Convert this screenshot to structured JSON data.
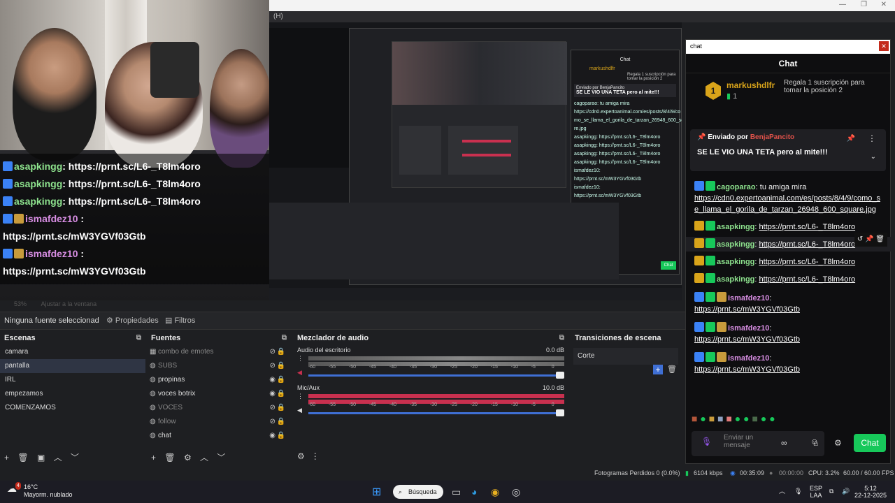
{
  "window": {
    "menu_fragment": "(H)"
  },
  "webcam_overlay": {
    "lines": [
      {
        "user": "asapkingg",
        "text": ": https://prnt.sc/L6-_T8lm4oro"
      },
      {
        "user": "asapkingg",
        "text": ": https://prnt.sc/L6-_T8lm4oro"
      },
      {
        "user": "asapkingg",
        "text": ": https://prnt.sc/L6-_T8lm4oro"
      },
      {
        "user": "ismafdez10",
        "text": " :"
      },
      {
        "user": "",
        "text": "https://prnt.sc/mW3YGVf03Gtb"
      },
      {
        "user": "ismafdez10",
        "text": " :"
      },
      {
        "user": "",
        "text": "https://prnt.sc/mW3YGVf03Gtb"
      }
    ]
  },
  "preview": {
    "zoom": "53%",
    "zoom_action": "Ajustar a la ventana",
    "nested_chat_title": "Chat",
    "nested_lines": [
      "cagoparao: tu amiga mira",
      "https://cdn0.expertoanimal.com/es/posts/8/4/9/co",
      "mo_se_llama_el_gorila_de_tarzan_26948_600_squa",
      "re.jpg",
      "asapkingg: https://prnt.sc/L6-_T8lm4oro",
      "asapkingg: https://prnt.sc/L6-_T8lm4oro",
      "asapkingg: https://prnt.sc/L6-_T8lm4oro",
      "asapkingg: https://prnt.sc/L6-_T8lm4oro",
      "ismafdez10:",
      "https://prnt.sc/mW3YGVf03Gtb",
      "ismafdez10:",
      "https://prnt.sc/mW3YGVf03Gtb"
    ],
    "nested_user": "markushdlfr",
    "nested_pin": "SE LE VIO UNA TETA pero al mite!!!",
    "nested_gift": "Regala 1 suscripción para tomar la posición 2",
    "nested_sent_by": "Enviado por BenjaPancito"
  },
  "properties_bar": {
    "selected": "Ninguna fuente seleccionad",
    "properties": "Propiedades",
    "filters": "Filtros"
  },
  "scenes": {
    "title": "Escenas",
    "items": [
      "camara",
      "pantalla",
      "IRL",
      "empezamos",
      "COMENZAMOS"
    ]
  },
  "sources": {
    "title": "Fuentes",
    "items": [
      {
        "name": "combo de emotes",
        "visible": false
      },
      {
        "name": "SUBS",
        "visible": false
      },
      {
        "name": "propinas",
        "visible": true
      },
      {
        "name": "voces botrix",
        "visible": true
      },
      {
        "name": "VOCES",
        "visible": false
      },
      {
        "name": "follow",
        "visible": false
      },
      {
        "name": "chat",
        "visible": true
      }
    ]
  },
  "mixer": {
    "title": "Mezclador de audio",
    "tracks": [
      {
        "name": "Audio del escritorio",
        "db": "0.0 dB"
      },
      {
        "name": "Mic/Aux",
        "db": "10.0 dB"
      }
    ],
    "ticks": [
      "-60",
      "-55",
      "-50",
      "-45",
      "-40",
      "-35",
      "-30",
      "-25",
      "-20",
      "-15",
      "-10",
      "-5",
      "0"
    ]
  },
  "transitions": {
    "title": "Transiciones de escena",
    "selected": "Corte"
  },
  "chat": {
    "window_title": "chat",
    "header": "Chat",
    "leader": {
      "rank": "1",
      "name": "markushdlfr",
      "count": "1",
      "gift_rank": "2",
      "gift_text": "Regala 1 suscripción para tomar la posición 2"
    },
    "pinned": {
      "by_label": "Enviado por",
      "by_user": "BenjaPancito",
      "text": "SE LE VIO UNA TETA pero al mite!!!"
    },
    "messages": [
      {
        "user": "cagoparao",
        "sep": ": ",
        "text": "tu amiga mira",
        "link": "https://cdn0.expertoanimal.com/es/posts/8/4/9/como_se_llama_el_gorila_de_tarzan_26948_600_square.jpg",
        "color": "#8ee38e"
      },
      {
        "user": "asapkingg",
        "sep": ": ",
        "text": "",
        "link": "https://prnt.sc/L6-_T8lm4oro",
        "color": "#8ee38e"
      },
      {
        "user": "asapkingg",
        "sep": ": ",
        "text": "",
        "link": "https://prnt.sc/L6-_T8lm4oro",
        "color": "#8ee38e"
      },
      {
        "user": "asapkingg",
        "sep": ": ",
        "text": "",
        "link": "https://prnt.sc/L6-_T8lm4oro",
        "color": "#8ee38e"
      },
      {
        "user": "asapkingg",
        "sep": ": ",
        "text": "",
        "link": "https://prnt.sc/L6-_T8lm4oro",
        "color": "#8ee38e"
      },
      {
        "user": "ismafdez10",
        "sep": ":",
        "text": "",
        "link": "https://prnt.sc/mW3YGVf03Gtb",
        "color": "#d88ee3"
      },
      {
        "user": "ismafdez10",
        "sep": ":",
        "text": "",
        "link": "https://prnt.sc/mW3YGVf03Gtb",
        "color": "#d88ee3"
      },
      {
        "user": "ismafdez10",
        "sep": ":",
        "text": "",
        "link": "https://prnt.sc/mW3YGVf03Gtb",
        "color": "#d88ee3"
      }
    ],
    "input_placeholder": "Enviar un mensaje",
    "send_label": "Chat"
  },
  "status": {
    "dropped": "Fotogramas Perdidos 0 (0.0%)",
    "kbps": "6104 kbps",
    "stream_time": "00:35:09",
    "rec_time": "00:00:00",
    "cpu": "CPU: 3.2%",
    "fps": "60.00 / 60.00 FPS"
  },
  "taskbar": {
    "temp": "16°C",
    "weather": "Mayorm. nublado",
    "search": "Búsqueda",
    "lang": "ESP",
    "lang2": "LAA",
    "time": "5:12",
    "date": "22-12-2025",
    "notif": "4"
  },
  "colors": {
    "green_user": "#8ee38e",
    "purple_user": "#d88ee3",
    "kick_green": "#17c85a",
    "mixer_red": "#c9304f",
    "slider_blue": "#3f6fd4"
  }
}
